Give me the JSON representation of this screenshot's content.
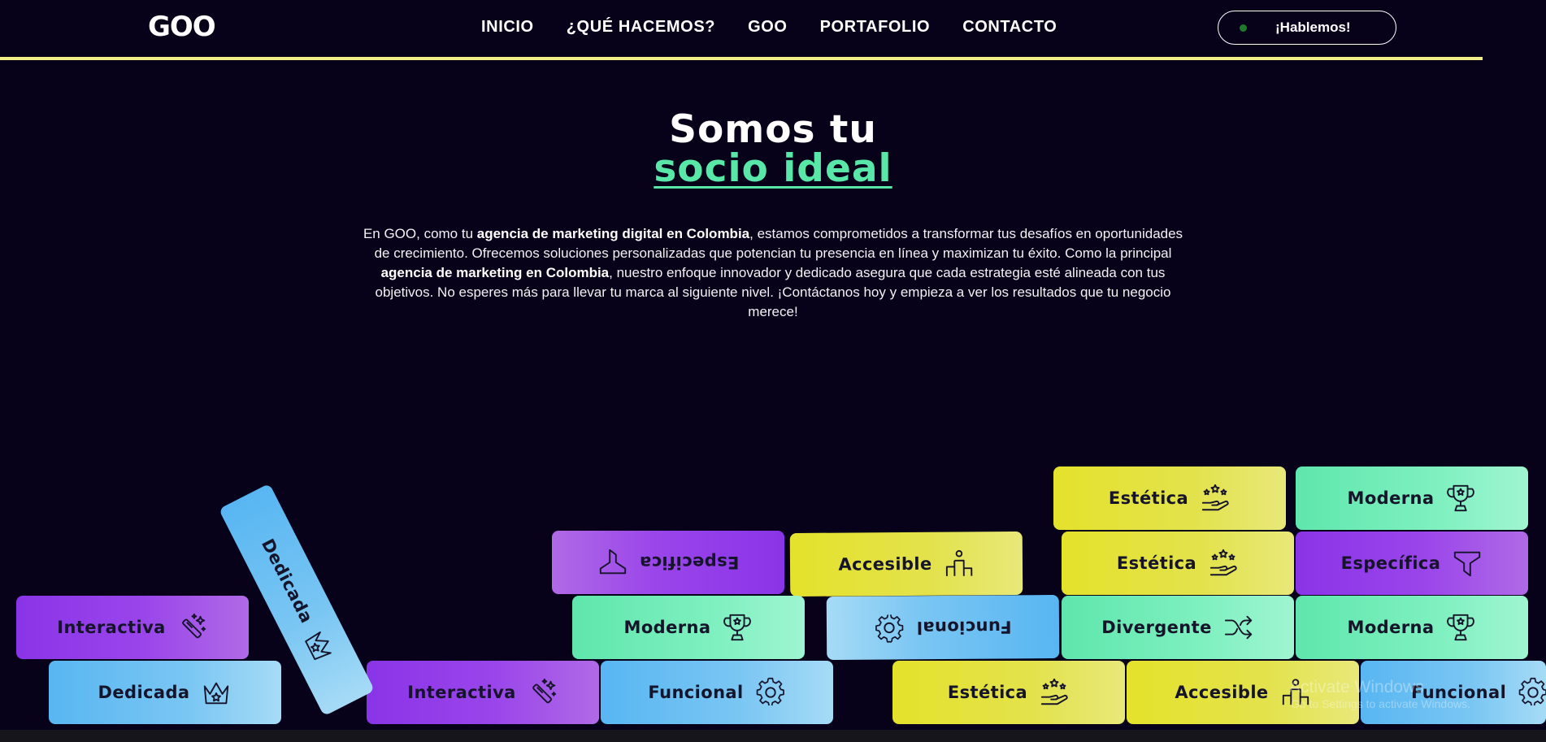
{
  "header": {
    "logo": "GOO",
    "nav": [
      "INICIO",
      "¿QUÉ HACEMOS?",
      "GOO",
      "PORTAFOLIO",
      "CONTACTO"
    ],
    "cta": "¡Hablemos!",
    "accent_line_color": "#f1ef86"
  },
  "hero": {
    "title_line1": "Somos tu",
    "title_line2": "socio ideal",
    "description": {
      "p1": "En GOO, como tu ",
      "b1": "agencia de marketing digital en Colombia",
      "p2": ", estamos comprometidos a transformar tus desafíos en oportunidades de crecimiento. Ofrecemos soluciones personalizadas que potencian tu presencia en línea y maximizan tu éxito. Como la principal ",
      "b2": "agencia de marketing en Colombia",
      "p3": ", nuestro enfoque innovador y dedicado asegura que cada estrategia esté alineada con tus objetivos. No esperes más para llevar tu marca al siguiente nivel. ¡Contáctanos hoy y empieza a ver los resultados que tu negocio merece!"
    }
  },
  "blocks": [
    {
      "label": "Interactiva",
      "icon": "magic-wand-icon",
      "color": "purple"
    },
    {
      "label": "Dedicada",
      "icon": "crown-icon",
      "color": "blue"
    },
    {
      "label": "Dedicada",
      "icon": "crown-icon",
      "color": "blue"
    },
    {
      "label": "Interactiva",
      "icon": "magic-wand-icon",
      "color": "purple"
    },
    {
      "label": "Especifica",
      "icon": "funnel-icon",
      "color": "purple"
    },
    {
      "label": "Moderna",
      "icon": "trophy-icon",
      "color": "mint"
    },
    {
      "label": "Funcional",
      "icon": "gear-icon",
      "color": "blue"
    },
    {
      "label": "Accesible",
      "icon": "person-podium-icon",
      "color": "yellow"
    },
    {
      "label": "Funcional",
      "icon": "gear-icon",
      "color": "blue"
    },
    {
      "label": "Estética",
      "icon": "stars-hand-icon",
      "color": "yellow"
    },
    {
      "label": "Estética",
      "icon": "stars-hand-icon",
      "color": "yellow"
    },
    {
      "label": "Estética",
      "icon": "stars-hand-icon",
      "color": "yellow"
    },
    {
      "label": "Divergente",
      "icon": "shuffle-icon",
      "color": "mint"
    },
    {
      "label": "Accesible",
      "icon": "person-podium-icon",
      "color": "yellow"
    },
    {
      "label": "Moderna",
      "icon": "trophy-icon",
      "color": "mint"
    },
    {
      "label": "Específica",
      "icon": "funnel-icon",
      "color": "purple"
    },
    {
      "label": "Moderna",
      "icon": "trophy-icon",
      "color": "mint"
    },
    {
      "label": "Funcional",
      "icon": "gear-icon",
      "color": "blue"
    }
  ],
  "watermark": {
    "line1": "Activate Windows",
    "line2": "Go to Settings to activate Windows."
  }
}
